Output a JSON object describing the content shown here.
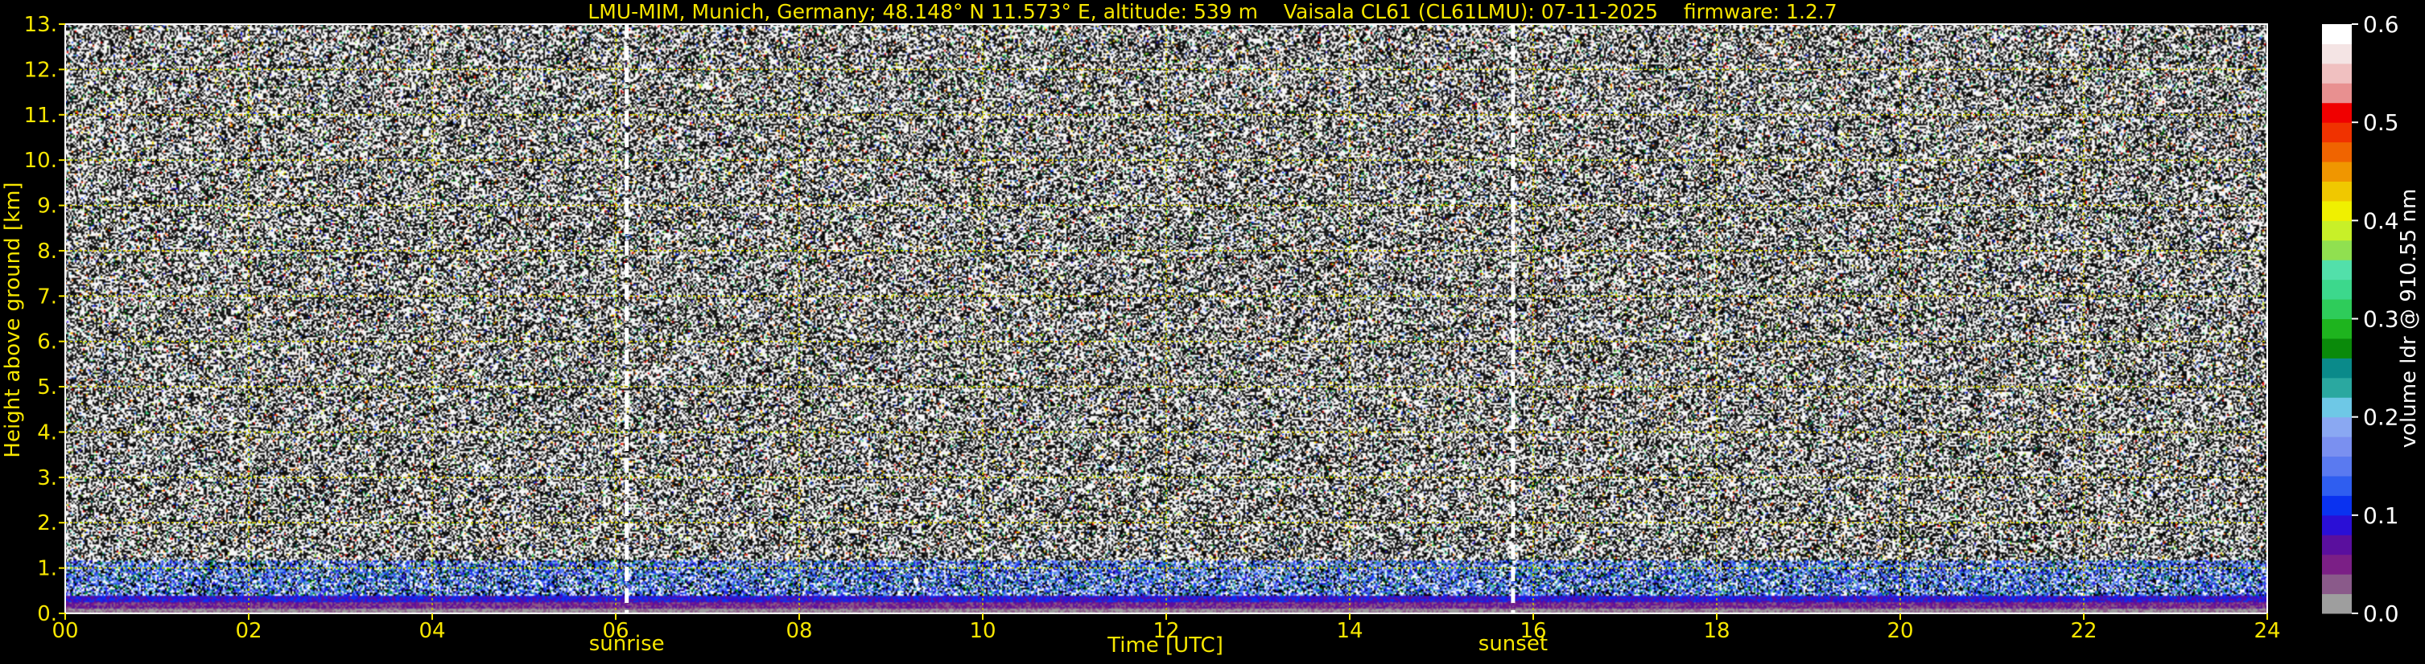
{
  "title": "LMU-MIM, Munich, Germany; 48.148° N 11.573° E, altitude: 539 m    Vaisala CL61 (CL61LMU): 07-11-2025    firmware: 1.2.7",
  "colors": {
    "text": "#f7e600",
    "grid": "#c8c800",
    "background": "#000000",
    "marker": "#ffffff"
  },
  "chart_data": {
    "type": "heatmap",
    "xlabel": "Time [UTC]",
    "ylabel": "Height above ground [km]",
    "xlim": [
      0,
      24
    ],
    "ylim": [
      0,
      13
    ],
    "xticks": [
      0,
      2,
      4,
      6,
      8,
      10,
      12,
      14,
      16,
      18,
      20,
      22,
      24
    ],
    "xtick_labels": [
      "00",
      "02",
      "04",
      "06",
      "08",
      "10",
      "12",
      "14",
      "16",
      "18",
      "20",
      "22",
      "24"
    ],
    "yticks": [
      0,
      1,
      2,
      3,
      4,
      5,
      6,
      7,
      8,
      9,
      10,
      11,
      12,
      13
    ],
    "ytick_labels": [
      "0.",
      "1.",
      "2.",
      "3.",
      "4.",
      "5.",
      "6.",
      "7.",
      "8.",
      "9.",
      "10.",
      "11.",
      "12.",
      "13."
    ],
    "grid": true,
    "markers": [
      {
        "label": "sunrise",
        "x": 6.12
      },
      {
        "label": "sunset",
        "x": 15.78
      }
    ],
    "colorbar": {
      "label": "volume ldr @ 910.55 nm",
      "range": [
        0.0,
        0.6
      ],
      "ticks": [
        0.0,
        0.1,
        0.2,
        0.3,
        0.4,
        0.5,
        0.6
      ],
      "tick_labels": [
        "0.0",
        "0.1",
        "0.2",
        "0.3",
        "0.4",
        "0.5",
        "0.6"
      ],
      "colors": [
        "#9e9e9e",
        "#8a5a8a",
        "#7b1f86",
        "#5a0f9e",
        "#2a0fd6",
        "#0a32f0",
        "#2f5ef0",
        "#5a7af0",
        "#7a90f0",
        "#8aa8f2",
        "#6ec8e6",
        "#2aa8a0",
        "#0a8a8a",
        "#0a8a0a",
        "#1eb41e",
        "#2ecc5a",
        "#3cd88c",
        "#52e0aa",
        "#90e050",
        "#c8f028",
        "#f0f000",
        "#f0c800",
        "#f09600",
        "#f06400",
        "#f03200",
        "#f00000",
        "#e89090",
        "#f0c0c0",
        "#f4e4e4",
        "#ffffff"
      ]
    }
  }
}
